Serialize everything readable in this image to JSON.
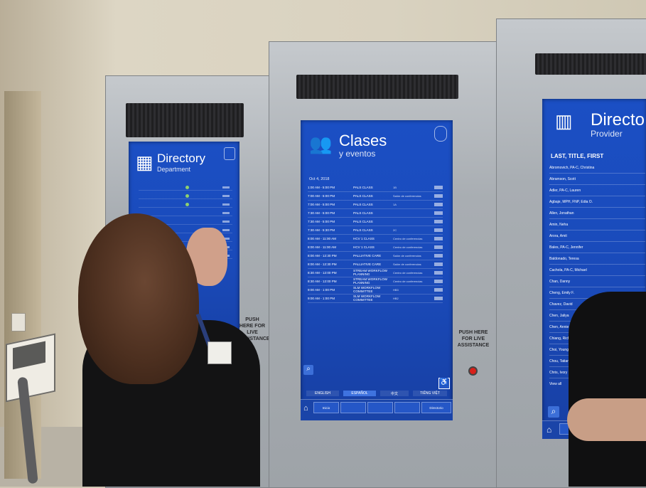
{
  "left_kiosk": {
    "title": "Directory",
    "subtitle": "Department",
    "push_text": "PUSH HERE FOR LIVE ASSISTANCE"
  },
  "center_kiosk": {
    "title": "Clases",
    "subtitle": "y eventos",
    "date": "Oct 4, 2018",
    "events": [
      {
        "time": "1:00 AM - 5:00 PM",
        "name": "PALS CLASS",
        "room": "1B"
      },
      {
        "time": "7:00 AM - 5:00 PM",
        "name": "PALS CLASS",
        "room": "Salón de conferencias"
      },
      {
        "time": "7:00 AM - 5:00 PM",
        "name": "PALS CLASS",
        "room": "1A"
      },
      {
        "time": "7:30 AM - 5:00 PM",
        "name": "PALS CLASS",
        "room": ""
      },
      {
        "time": "7:30 AM - 5:00 PM",
        "name": "PALS CLASS",
        "room": ""
      },
      {
        "time": "7:30 AM - 5:30 PM",
        "name": "PALS CLASS",
        "room": "2C"
      },
      {
        "time": "8:00 AM - 11:00 AM",
        "name": "HCV 1 CLASS",
        "room": "Centro de conferencias"
      },
      {
        "time": "8:00 AM - 11:00 AM",
        "name": "HCV 1 CLASS",
        "room": "Centro de conferencias"
      },
      {
        "time": "8:00 AM - 12:30 PM",
        "name": "PALLIATIVE CARE",
        "room": "Salón de conferencias"
      },
      {
        "time": "8:00 AM - 12:30 PM",
        "name": "PALLIATIVE CARE",
        "room": "Salón de conferencias"
      },
      {
        "time": "8:30 AM - 12:00 PM",
        "name": "STREAM WORKFLOW PLANNING",
        "room": "Centro de conferencias"
      },
      {
        "time": "8:30 AM - 12:00 PM",
        "name": "STREAM WORKFLOW PLANNING",
        "room": "Centro de conferencias"
      },
      {
        "time": "9:00 AM - 1:00 PM",
        "name": "SLM WORKFLOW COMMITTEE",
        "room": "HB3"
      },
      {
        "time": "9:00 AM - 1:00 PM",
        "name": "SLM WORKFLOW COMMITTEE",
        "room": "HB2"
      }
    ],
    "languages": [
      "ENGLISH",
      "ESPAÑOL",
      "中文",
      "TIẾNG VIỆT"
    ],
    "nav": [
      "Inicio",
      "Directorio"
    ],
    "push_text": "PUSH HERE FOR LIVE ASSISTANCE"
  },
  "right_kiosk": {
    "title": "Directo",
    "subtitle": "Provider",
    "column_header": "LAST, TITLE, FIRST",
    "providers": [
      "Abromovich, PA-C, Christina",
      "Abramson, Scott",
      "Adler, PA-C, Lauren",
      "Agbaje, MPH, FNP, Edia O.",
      "Allen, Jonathan",
      "Amin, Neha",
      "Arora, Amit",
      "Bales, PA-C, Jennifer",
      "Baldonado, Teresa",
      "Cachola, PA-C, Michael",
      "Chan, Danny",
      "Cheng, Emily F.",
      "Chavez, David",
      "Chen, Jaliya",
      "Chen, Annie",
      "Chiang, Richard",
      "Choi, Young (Nancy)",
      "Chou, Tatiana",
      "Chris, Ivory",
      "View all"
    ]
  }
}
